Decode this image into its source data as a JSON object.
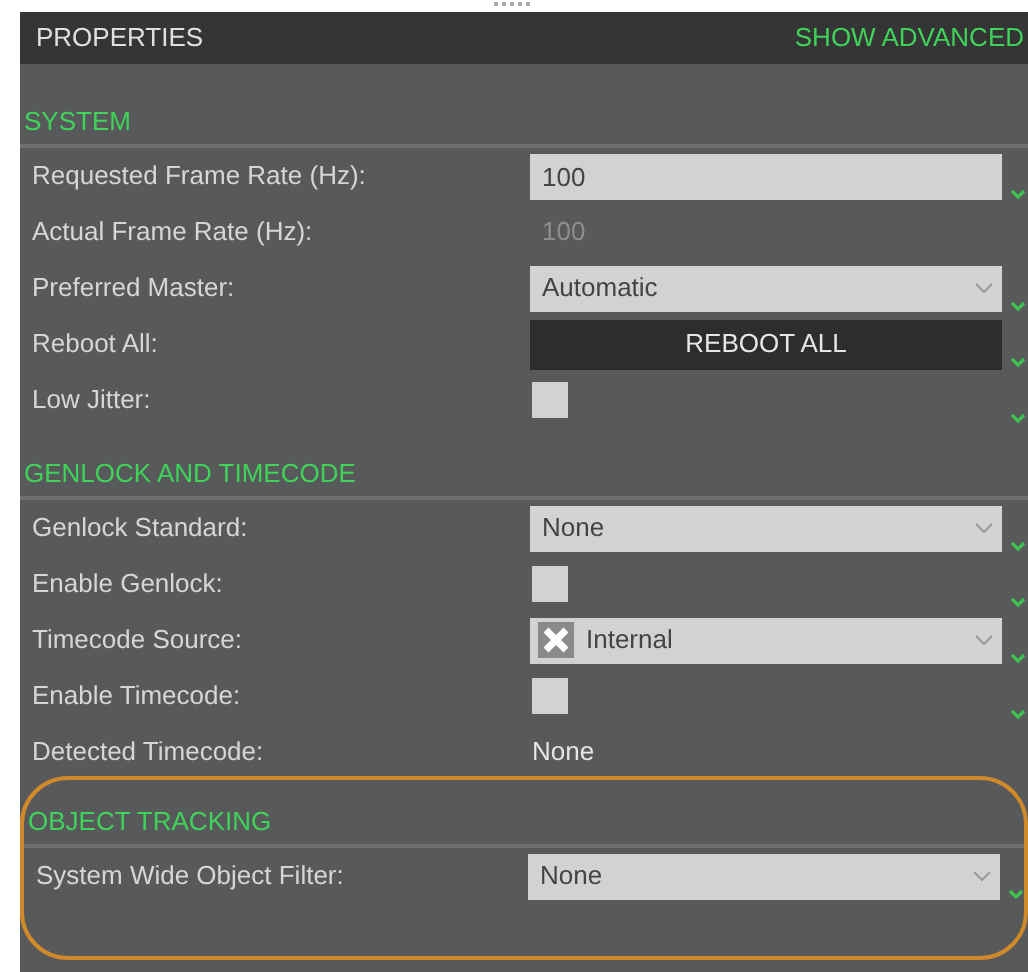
{
  "header": {
    "title": "PROPERTIES",
    "action": "SHOW ADVANCED"
  },
  "sections": [
    {
      "title": "SYSTEM",
      "highlighted": false,
      "rows": [
        {
          "label": "Requested Frame Rate (Hz):",
          "kind": "input",
          "value": "100"
        },
        {
          "label": "Actual Frame Rate (Hz):",
          "kind": "readonly",
          "value": "100"
        },
        {
          "label": "Preferred Master:",
          "kind": "dropdown",
          "value": "Automatic"
        },
        {
          "label": "Reboot All:",
          "kind": "button",
          "value": "REBOOT ALL"
        },
        {
          "label": "Low Jitter:",
          "kind": "checkbox",
          "checked": false
        }
      ]
    },
    {
      "title": "GENLOCK AND TIMECODE",
      "highlighted": false,
      "rows": [
        {
          "label": "Genlock Standard:",
          "kind": "dropdown",
          "value": "None"
        },
        {
          "label": "Enable Genlock:",
          "kind": "checkbox",
          "checked": false
        },
        {
          "label": "Timecode Source:",
          "kind": "dropdown",
          "value": "Internal",
          "has_icon": true
        },
        {
          "label": "Enable Timecode:",
          "kind": "checkbox",
          "checked": false
        },
        {
          "label": "Detected Timecode:",
          "kind": "text",
          "value": "None"
        }
      ]
    },
    {
      "title": "OBJECT TRACKING",
      "highlighted": true,
      "rows": [
        {
          "label": "System Wide Object Filter:",
          "kind": "dropdown",
          "value": "None"
        }
      ]
    }
  ]
}
